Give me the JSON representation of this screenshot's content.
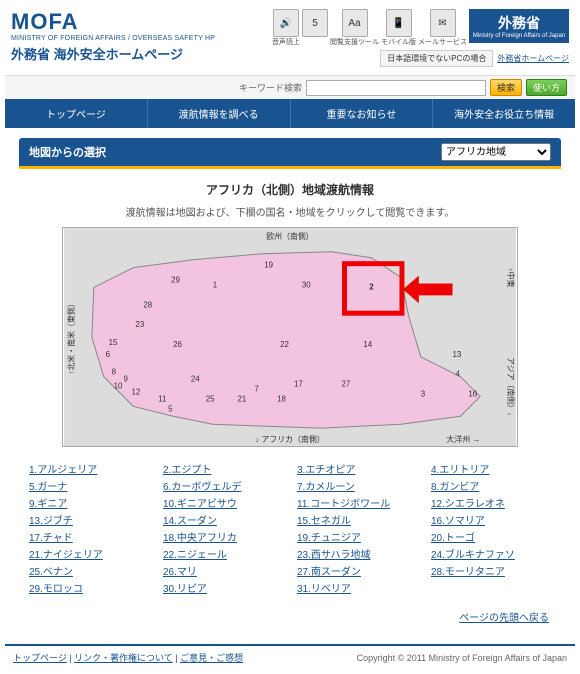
{
  "logo": {
    "text": "MOFA",
    "sub": "MINISTRY OF FOREIGN AFFAIRS / OVERSEAS SAFETY HP",
    "title": "外務省 海外安全ホームページ"
  },
  "header": {
    "badges": [
      {
        "icon": "🔊",
        "label": "音声読上"
      },
      {
        "icon": "5",
        "label": ""
      },
      {
        "icon": "Aa",
        "label": "閲覧支援ツール"
      },
      {
        "icon": "📱",
        "label": "モバイル版"
      },
      {
        "icon": "✉",
        "label": "メールサービス"
      }
    ],
    "mofa_badge": {
      "title": "外務省",
      "sub": "Ministry of Foreign Affairs of Japan"
    },
    "notice": "日本語環境でないPCの場合",
    "mofa_link": "外務省ホームページ"
  },
  "search": {
    "label": "キーワード検索",
    "placeholder": "",
    "search_btn": "検索",
    "usage_btn": "使い方"
  },
  "nav": [
    "トップページ",
    "渡航情報を調べる",
    "重要なお知らせ",
    "海外安全お役立ち情報"
  ],
  "section": {
    "bar_title": "地図からの選択",
    "region_options": [
      "アフリカ地域"
    ],
    "title": "アフリカ（北側）地域渡航情報",
    "desc": "渡航情報は地図および、下欄の国名・地域をクリックして閲覧できます。"
  },
  "map": {
    "labels": {
      "north": "欧州（南側）",
      "south": "↓ アフリカ（南側）",
      "west": "↑北米・南米（東側）",
      "east_top": "↑中東",
      "east_bottom": "アジア（南側）↓",
      "southeast": "大洋州 →"
    },
    "numbers": [
      1,
      2,
      3,
      4,
      5,
      6,
      7,
      8,
      9,
      10,
      11,
      12,
      13,
      14,
      15,
      16,
      17,
      18,
      19,
      21,
      22,
      23,
      24,
      25,
      26,
      27,
      28,
      29,
      30
    ],
    "highlighted": 2
  },
  "countries": [
    [
      "1.アルジェリア",
      "5.ガーナ",
      "9.ギニア",
      "13.ジブチ",
      "17.チャド",
      "21.ナイジェリア",
      "25.ベナン",
      "29.モロッコ"
    ],
    [
      "2.エジプト",
      "6.カーボヴェルデ",
      "10.ギニアビサウ",
      "14.スーダン",
      "18.中央アフリカ",
      "22.ニジェール",
      "26.マリ",
      "30.リビア"
    ],
    [
      "3.エチオピア",
      "7.カメルーン",
      "11.コートジボワール",
      "15.セネガル",
      "19.チュニジア",
      "23.西サハラ地域",
      "27.南スーダン",
      "31.リベリア"
    ],
    [
      "4.エリトリア",
      "8.ガンビア",
      "12.シエラレオネ",
      "16.ソマリア",
      "20.トーゴ",
      "24.ブルキナファソ",
      "28.モーリタニア"
    ]
  ],
  "page_top": "ページの先頭へ戻る",
  "footer": {
    "links": [
      "トップページ",
      "リンク・著作権について",
      "ご意見・ご感想"
    ],
    "sep": " | ",
    "copyright": "Copyright © 2011 Ministry of Foreign Affairs of Japan"
  }
}
